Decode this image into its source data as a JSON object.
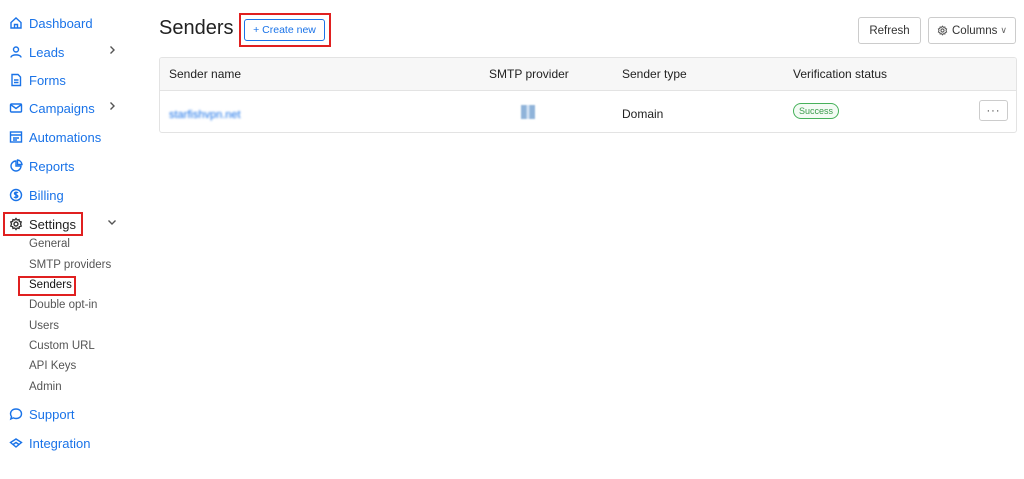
{
  "sidebar": {
    "items": [
      {
        "label": "Dashboard",
        "icon": "home-icon"
      },
      {
        "label": "Leads",
        "icon": "user-icon",
        "chevron": "right"
      },
      {
        "label": "Forms",
        "icon": "file-icon"
      },
      {
        "label": "Campaigns",
        "icon": "mail-icon",
        "chevron": "right"
      },
      {
        "label": "Automations",
        "icon": "automation-icon"
      },
      {
        "label": "Reports",
        "icon": "pie-chart-icon"
      },
      {
        "label": "Billing",
        "icon": "dollar-icon"
      },
      {
        "label": "Settings",
        "icon": "gear-icon",
        "chevron": "down",
        "active": true
      },
      {
        "label": "Support",
        "icon": "chat-icon"
      },
      {
        "label": "Integration",
        "icon": "integration-icon"
      }
    ],
    "settings_sub": [
      "General",
      "SMTP providers",
      "Senders",
      "Double opt-in",
      "Users",
      "Custom URL",
      "API Keys",
      "Admin"
    ]
  },
  "header": {
    "title": "Senders",
    "create_label": "+ Create new",
    "refresh_label": "Refresh",
    "columns_label": "Columns"
  },
  "table": {
    "columns": [
      "Sender name",
      "SMTP provider",
      "Sender type",
      "Verification status"
    ],
    "rows": [
      {
        "sender_name": "starfishvpn.net",
        "sender_type": "Domain",
        "status": "Success",
        "more": "···"
      }
    ]
  },
  "colors": {
    "accent": "#1a73e8",
    "highlight": "#e02020",
    "success": "#46b15a"
  }
}
